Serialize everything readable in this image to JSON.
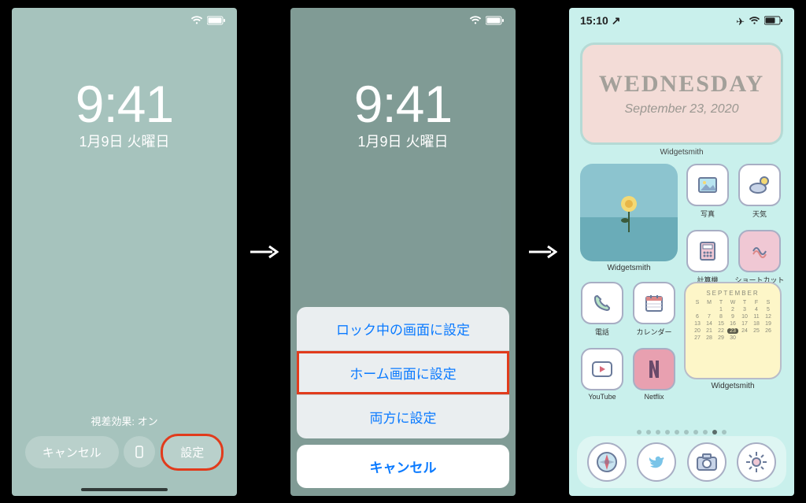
{
  "screen1": {
    "time": "9:41",
    "date": "1月9日 火曜日",
    "parallax_label": "視差効果: オン",
    "cancel": "キャンセル",
    "set": "設定"
  },
  "screen2": {
    "time": "9:41",
    "date": "1月9日 火曜日",
    "option_lock": "ロック中の画面に設定",
    "option_home": "ホーム画面に設定",
    "option_both": "両方に設定",
    "cancel": "キャンセル"
  },
  "screen3": {
    "status_time": "15:10",
    "widget_day": "WEDNESDAY",
    "widget_date": "September 23, 2020",
    "widget_label": "Widgetsmith",
    "calendar_month": "SEPTEMBER",
    "calendar_today": 23,
    "apps": {
      "photos": "写真",
      "weather": "天気",
      "calculator": "計算機",
      "shortcuts": "ショートカット",
      "phone": "電話",
      "calendar": "カレンダー",
      "youtube": "YouTube",
      "netflix": "Netflix",
      "widgetsmith": "Widgetsmith",
      "widgetsmith2": "Widgetsmith"
    }
  }
}
